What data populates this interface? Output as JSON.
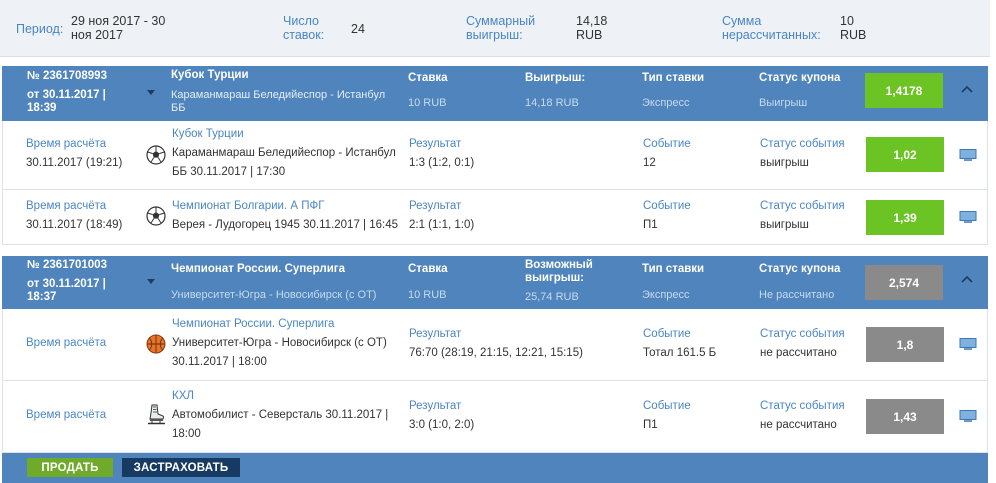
{
  "summary": {
    "period_label": "Период:",
    "period_value_1": "29 ноя 2017 - 30",
    "period_value_2": "ноя 2017",
    "bets_label_1": "Число",
    "bets_label_2": "ставок:",
    "bets_value": "24",
    "win_label_1": "Суммарный",
    "win_label_2": "выигрыш:",
    "win_value_1": "14,18",
    "win_value_2": "RUB",
    "unsettled_label_1": "Сумма",
    "unsettled_label_2": "нерассчитанных:",
    "unsettled_value_1": "10",
    "unsettled_value_2": "RUB"
  },
  "coupons": [
    {
      "number": "№ 2361708993",
      "date_1": "от 30.11.2017 |",
      "date_2": "18:39",
      "tournament": "Кубок Турции",
      "match_1": "Караманмараш Беледийеспор - Истанбул",
      "match_2": "ББ",
      "stake_label": "Ставка",
      "stake_value": "10 RUB",
      "win_label_1": "Выигрыш:",
      "win_label_2": "",
      "win_value": "14,18 RUB",
      "type_label": "Тип ставки",
      "type_value": "Экспресс",
      "status_label": "Статус купона",
      "status_value": "Выигрыш",
      "odds": "1,4178",
      "events": [
        {
          "calc_label": "Время расчёта",
          "calc_time": "30.11.2017 (19:21)",
          "sport_icon": "football-icon",
          "tournament": "Кубок Турции",
          "match_1": "Караманмараш Беледийеспор - Истанбул",
          "match_2": "ББ 30.11.2017 | 17:30",
          "result_label": "Результат",
          "result_value": "1:3 (1:2, 0:1)",
          "event_label": "Событие",
          "event_value": "12",
          "status_label": "Статус события",
          "status_value": "выигрыш",
          "odds": "1,02"
        },
        {
          "calc_label": "Время расчёта",
          "calc_time": "30.11.2017 (18:49)",
          "sport_icon": "football-icon",
          "tournament": "Чемпионат Болгарии. А ПФГ",
          "match_1": "Верея - Лудогорец 1945 30.11.2017 | 16:45",
          "match_2": "",
          "result_label": "Результат",
          "result_value": "2:1 (1:1, 1:0)",
          "event_label": "Событие",
          "event_value": "П1",
          "status_label": "Статус события",
          "status_value": "выигрыш",
          "odds": "1,39"
        }
      ]
    },
    {
      "number": "№ 2361701003",
      "date_1": "от 30.11.2017 |",
      "date_2": "18:37",
      "tournament": "Чемпионат России. Суперлига",
      "match_1": "Университет-Югра - Новосибирск (с ОТ)",
      "match_2": "",
      "stake_label": "Ставка",
      "stake_value": "10 RUB",
      "win_label_1": "Возможный",
      "win_label_2": "выигрыш:",
      "win_value": "25,74 RUB",
      "type_label": "Тип ставки",
      "type_value": "Экспресс",
      "status_label": "Статус купона",
      "status_value": "Не рассчитано",
      "odds": "2,574",
      "events": [
        {
          "calc_label": "Время расчёта",
          "calc_time": "",
          "sport_icon": "basketball-icon",
          "tournament": "Чемпионат России. Суперлига",
          "match_1": "Университет-Югра - Новосибирск (с ОТ)",
          "match_2": "30.11.2017 | 18:00",
          "result_label": "Результат",
          "result_value": "76:70 (28:19, 21:15, 12:21, 15:15)",
          "event_label": "Событие",
          "event_value": "Тотал 161.5 Б",
          "status_label": "Статус события",
          "status_value": "не рассчитано",
          "odds": "1,8"
        },
        {
          "calc_label": "Время расчёта",
          "calc_time": "",
          "sport_icon": "ice-skate-icon",
          "tournament": "КХЛ",
          "match_1": "Автомобилист - Северсталь 30.11.2017 |",
          "match_2": "18:00",
          "result_label": "Результат",
          "result_value": "3:0 (1:0, 2:0)",
          "event_label": "Событие",
          "event_value": "П1",
          "status_label": "Статус события",
          "status_value": "не рассчитано",
          "odds": "1,43"
        }
      ]
    }
  ],
  "footer": {
    "sell_label": "ПРОДАТЬ",
    "insure_label": "ЗАСТРАХОВАТЬ"
  },
  "colors": {
    "header_blue": "#4f84bc",
    "label_blue": "#4a86c5",
    "win_green": "#6cc324",
    "pending_gray": "#8a8a8a",
    "sell_green": "#6faa2b",
    "insure_navy": "#173a63"
  }
}
